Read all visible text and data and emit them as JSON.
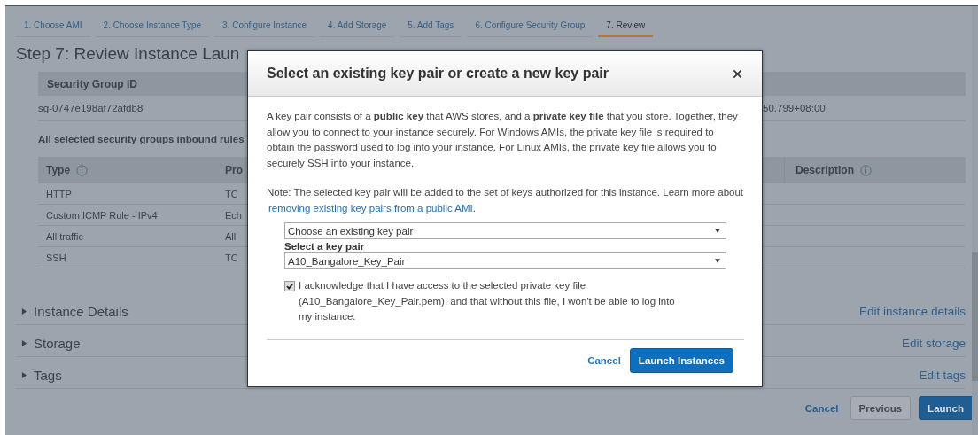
{
  "wizard_tabs": [
    {
      "label": "1. Choose AMI",
      "selected": false
    },
    {
      "label": "2. Choose Instance Type",
      "selected": false
    },
    {
      "label": "3. Configure Instance",
      "selected": false
    },
    {
      "label": "4. Add Storage",
      "selected": false
    },
    {
      "label": "5. Add Tags",
      "selected": false
    },
    {
      "label": "6. Configure Security Group",
      "selected": false
    },
    {
      "label": "7. Review",
      "selected": true
    }
  ],
  "page_title": "Step 7: Review Instance Laun",
  "security_groups": {
    "header": "Security Group ID",
    "row": [
      "sg-0747e198af72afdb8",
      "50.799+08:00"
    ]
  },
  "inbound_rules": {
    "title": "All selected security groups inbound rules",
    "columns": [
      {
        "label": "Type",
        "info": true
      },
      {
        "label": "Pro",
        "info": false
      },
      {
        "label": "Description",
        "info": true
      }
    ],
    "rows": [
      [
        "HTTP",
        "TC"
      ],
      [
        "Custom ICMP Rule - IPv4",
        "Ech"
      ],
      [
        "All traffic",
        "All"
      ],
      [
        "SSH",
        "TC"
      ]
    ]
  },
  "sections": [
    {
      "label": "Instance Details",
      "action": "Edit instance details",
      "expanded": false
    },
    {
      "label": "Storage",
      "action": "Edit storage",
      "expanded": false
    },
    {
      "label": "Tags",
      "action": "Edit tags",
      "expanded": false
    }
  ],
  "footer": {
    "cancel": "Cancel",
    "previous": "Previous",
    "launch": "Launch"
  },
  "dialog": {
    "title": "Select an existing key pair or create a new key pair",
    "description": "A key pair consists of a **public key** that AWS stores, and a **private key file** that you store. Together, they allow you to connect to your instance securely. For Windows AMIs, the private key file is required to obtain the password used to log into your instance. For Linux AMIs, the private key file allows you to securely SSH into your instance.",
    "note": "Note: The selected key pair will be added to the set of keys authorized for this instance. Learn more about",
    "note_link": "removing existing key pairs from a public AMI",
    "note_end": ".",
    "mode_select": {
      "value": "Choose an existing key pair"
    },
    "key_pair_label": "Select a key pair",
    "key_pair_select": {
      "value": "A10_Bangalore_Key_Pair"
    },
    "acknowledge": {
      "checked": true,
      "text": "I acknowledge that I have access to the selected private key file (A10_Bangalore_Key_Pair.pem), and that without this file, I won't be able to log into my instance."
    },
    "buttons": {
      "cancel": "Cancel",
      "launch": "Launch Instances"
    }
  }
}
